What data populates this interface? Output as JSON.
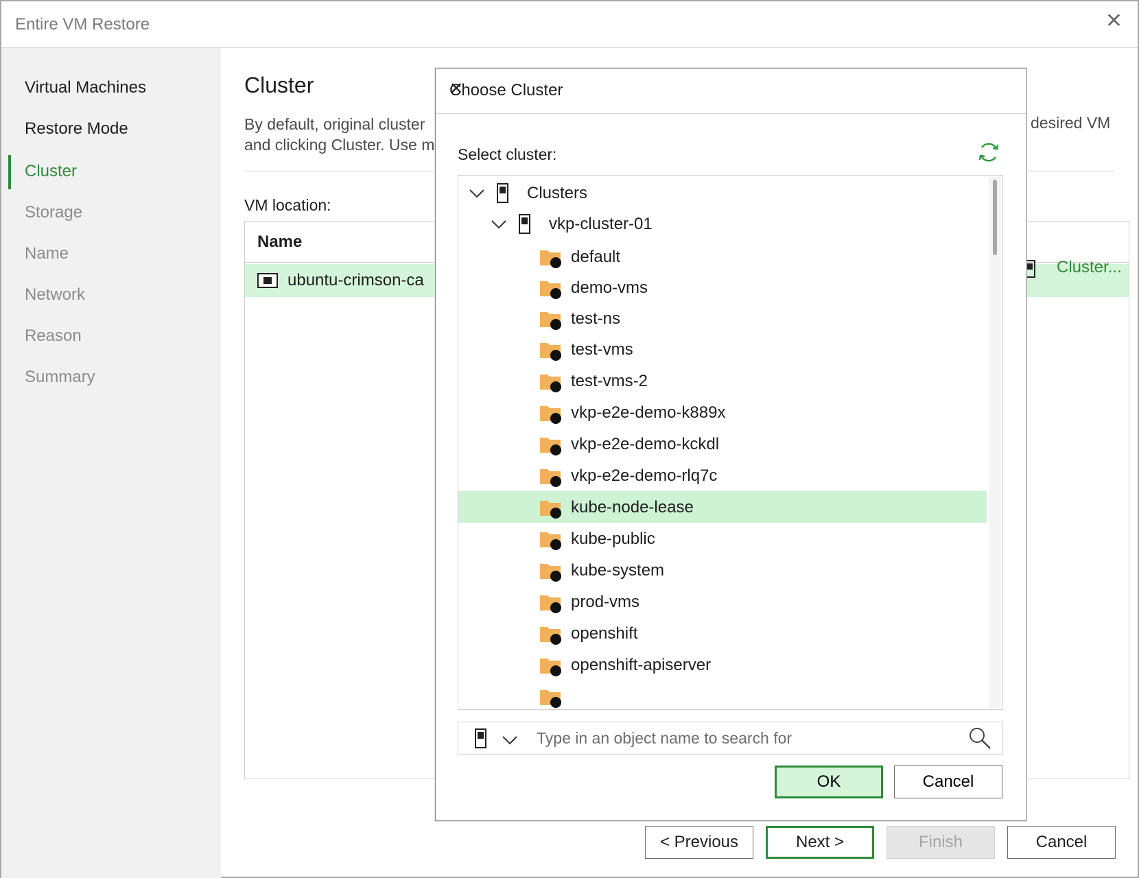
{
  "window": {
    "title": "Entire VM Restore"
  },
  "steps": [
    {
      "label": "Virtual Machines",
      "state": "done"
    },
    {
      "label": "Restore Mode",
      "state": "done"
    },
    {
      "label": "Cluster",
      "state": "active"
    },
    {
      "label": "Storage",
      "state": "pending"
    },
    {
      "label": "Name",
      "state": "pending"
    },
    {
      "label": "Network",
      "state": "pending"
    },
    {
      "label": "Reason",
      "state": "pending"
    },
    {
      "label": "Summary",
      "state": "pending"
    }
  ],
  "page": {
    "title": "Cluster",
    "desc_line1": "By default, original cluster",
    "desc_line2": "and clicking Cluster. Use m",
    "desc_right": "desired VM",
    "vm_location_label": "VM location:",
    "table_header": "Name",
    "vm_row_name": "ubuntu-crimson-ca",
    "cluster_link": "Cluster..."
  },
  "wizard_buttons": {
    "previous": "< Previous",
    "next": "Next >",
    "finish": "Finish",
    "cancel": "Cancel"
  },
  "dialog": {
    "title": "Choose Cluster",
    "select_label": "Select cluster:",
    "tree": {
      "root": "Clusters",
      "cluster": "vkp-cluster-01",
      "namespaces": [
        "default",
        "demo-vms",
        "test-ns",
        "test-vms",
        "test-vms-2",
        "vkp-e2e-demo-k889x",
        "vkp-e2e-demo-kckdl",
        "vkp-e2e-demo-rlq7c",
        "kube-node-lease",
        "kube-public",
        "kube-system",
        "prod-vms",
        "openshift",
        "openshift-apiserver"
      ],
      "selected": "kube-node-lease"
    },
    "search_placeholder": "Type in an object name to search for",
    "ok": "OK",
    "cancel": "Cancel"
  },
  "colors": {
    "accent": "#2e8b3a",
    "selection": "#cdf2d4",
    "folder": "#f0b15a"
  },
  "icons": [
    "close-icon",
    "server-icon",
    "folder-namespace-icon",
    "chevron-down-icon",
    "refresh-icon",
    "search-icon",
    "vm-icon"
  ]
}
